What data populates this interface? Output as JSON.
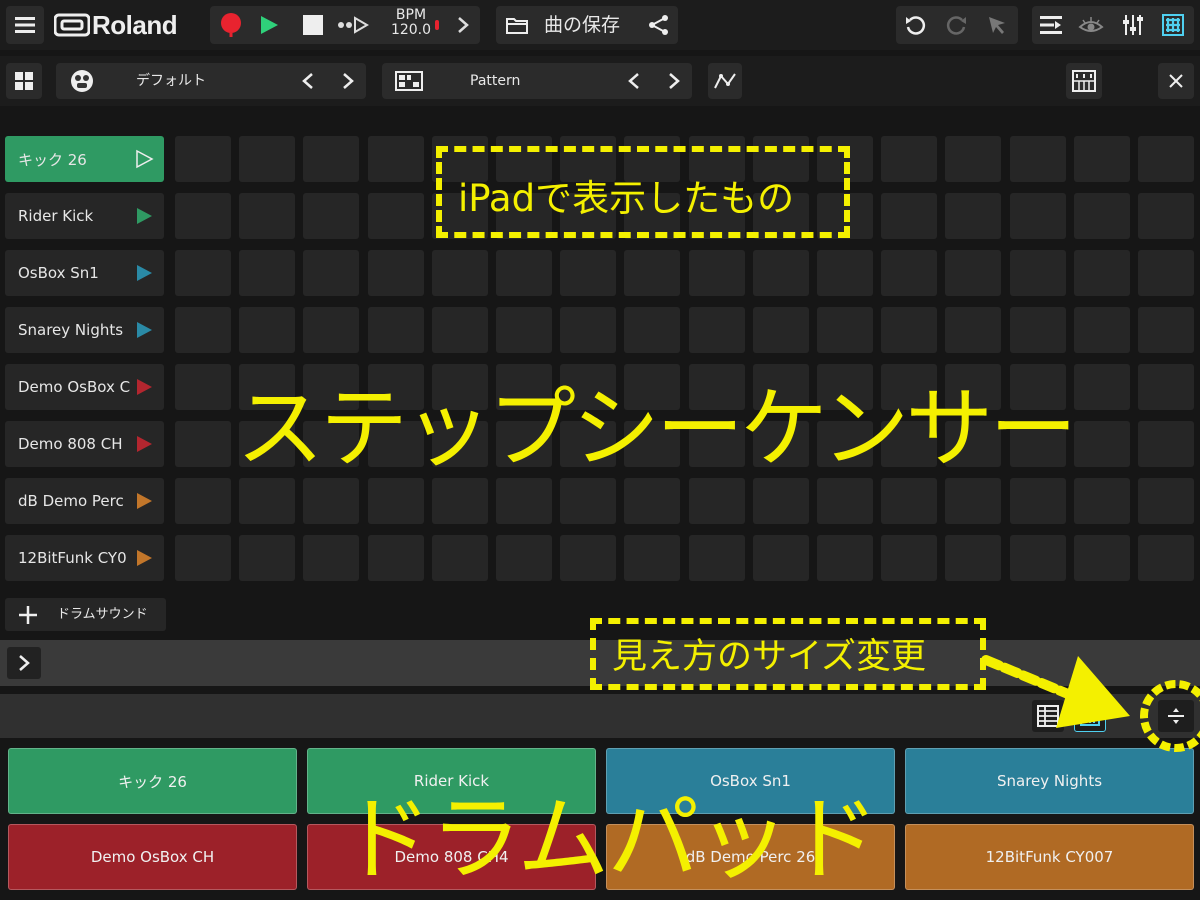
{
  "toolbar": {
    "logo": "Roland",
    "bpm_label": "BPM",
    "bpm_value": "120.0",
    "save_label": "曲の保存"
  },
  "subbar": {
    "kit_name": "デフォルト",
    "pattern_name": "Pattern"
  },
  "tracks": [
    {
      "name": "キック 26",
      "color": "#2f9a63"
    },
    {
      "name": "Rider Kick",
      "color": "#2f9a63"
    },
    {
      "name": "OsBox Sn1",
      "color": "#2a8aa6"
    },
    {
      "name": "Snarey Nights",
      "color": "#2a8aa6"
    },
    {
      "name": "Demo OsBox C",
      "color": "#b3262f"
    },
    {
      "name": "Demo 808 CH",
      "color": "#b3262f"
    },
    {
      "name": "dB Demo Perc",
      "color": "#c2762a"
    },
    {
      "name": "12BitFunk CY0",
      "color": "#c2762a"
    }
  ],
  "add_drum_label": "ドラムサウンド",
  "pads": [
    {
      "label": "キック 26",
      "color": "#2f9a63"
    },
    {
      "label": "Rider Kick",
      "color": "#2f9a63"
    },
    {
      "label": "OsBox Sn1",
      "color": "#2a7f99"
    },
    {
      "label": "Snarey Nights",
      "color": "#2a7f99"
    },
    {
      "label": "Demo OsBox CH",
      "color": "#9c2129"
    },
    {
      "label": "Demo 808 CH4",
      "color": "#9c2129"
    },
    {
      "label": "dB Demo Perc 26",
      "color": "#b06a24"
    },
    {
      "label": "12BitFunk CY007",
      "color": "#b06a24"
    }
  ],
  "annotations": {
    "ipad_note": "iPadで表示したもの",
    "step_seq": "ステップシーケンサー",
    "resize_note": "見え方のサイズ変更",
    "drum_pad": "ドラムパッド"
  },
  "colors": {
    "accent_green": "#2fd17a",
    "record_red": "#e8232f",
    "annotation_yellow": "#f4f000"
  }
}
